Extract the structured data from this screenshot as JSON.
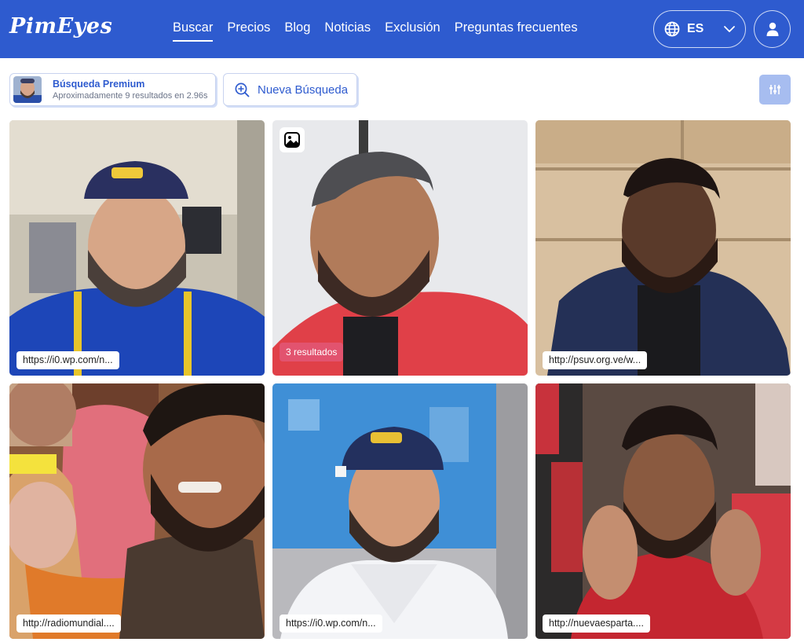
{
  "brand": {
    "name": "PimEyes"
  },
  "nav": {
    "items": [
      {
        "label": "Buscar",
        "active": true
      },
      {
        "label": "Precios"
      },
      {
        "label": "Blog"
      },
      {
        "label": "Noticias"
      },
      {
        "label": "Exclusión"
      },
      {
        "label": "Preguntas frecuentes"
      }
    ]
  },
  "language": {
    "code": "ES"
  },
  "search": {
    "premium_title": "Búsqueda Premium",
    "premium_subtitle": "Aproximadamente 9 resultados en 2.96s",
    "new_search_label": "Nueva Búsqueda"
  },
  "results": [
    {
      "url": "https://i0.wp.com/n...",
      "icon": "photo-shirt-blue"
    },
    {
      "count_label": "3 resultados",
      "badge_icon": "image-icon",
      "icon": "photo-shirt-red"
    },
    {
      "url": "http://psuv.org.ve/w...",
      "icon": "photo-jacket-navy"
    },
    {
      "url": "http://radiomundial....",
      "icon": "photo-selfie-group"
    },
    {
      "url": "https://i0.wp.com/n...",
      "icon": "photo-cap-white-shirt"
    },
    {
      "url": "http://nuevaesparta....",
      "icon": "photo-crowd-red"
    }
  ],
  "colors": {
    "brand_blue": "#2e5bcf",
    "count_badge": "#e2536f",
    "filter_button": "#a7bdf0"
  }
}
